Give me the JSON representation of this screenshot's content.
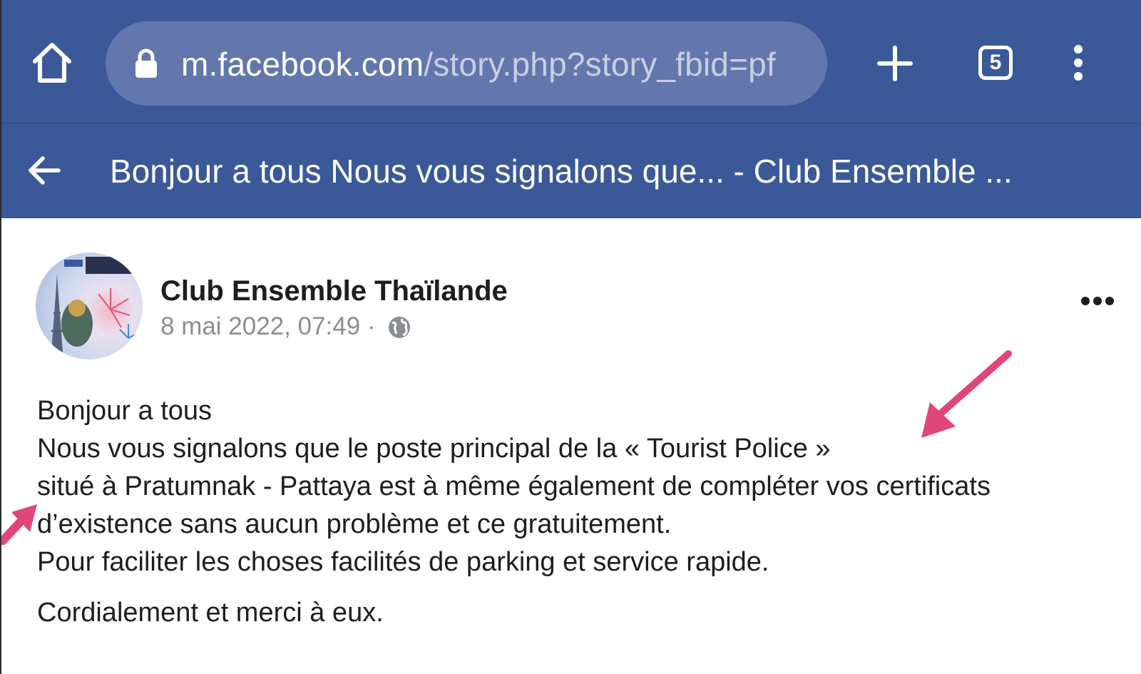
{
  "browser": {
    "url_domain": "m.facebook.com",
    "url_path": "/story.php?story_fbid=pf",
    "tab_count": "5",
    "icons": [
      "home-icon",
      "lock-icon",
      "plus-icon",
      "tabs-icon",
      "more-vert-icon"
    ]
  },
  "header": {
    "title": "Bonjour a tous Nous vous signalons que... - Club Ensemble ...",
    "back_icon": "back-arrow-icon"
  },
  "post": {
    "author": "Club Ensemble Thaïlande",
    "timestamp": "8 mai 2022, 07:49",
    "separator": "·",
    "privacy_icon": "globe-icon",
    "more_icon": "more-horizontal-icon",
    "lines": [
      "Bonjour a tous",
      "Nous vous signalons que le poste principal de la « Tourist Police »",
      "situé à Pratumnak - Pattaya est à même également de compléter vos certificats",
      "d’existence sans aucun problème et ce gratuitement.",
      "Pour faciliter les choses facilités de parking et service rapide."
    ],
    "closing": "Cordialement et merci à eux."
  },
  "colors": {
    "brand_bar": "#3b5998",
    "url_pill": "#6377ad",
    "annotation_arrow": "#e0457b",
    "text": "#1c1e21",
    "meta_text": "#8a8d91"
  }
}
